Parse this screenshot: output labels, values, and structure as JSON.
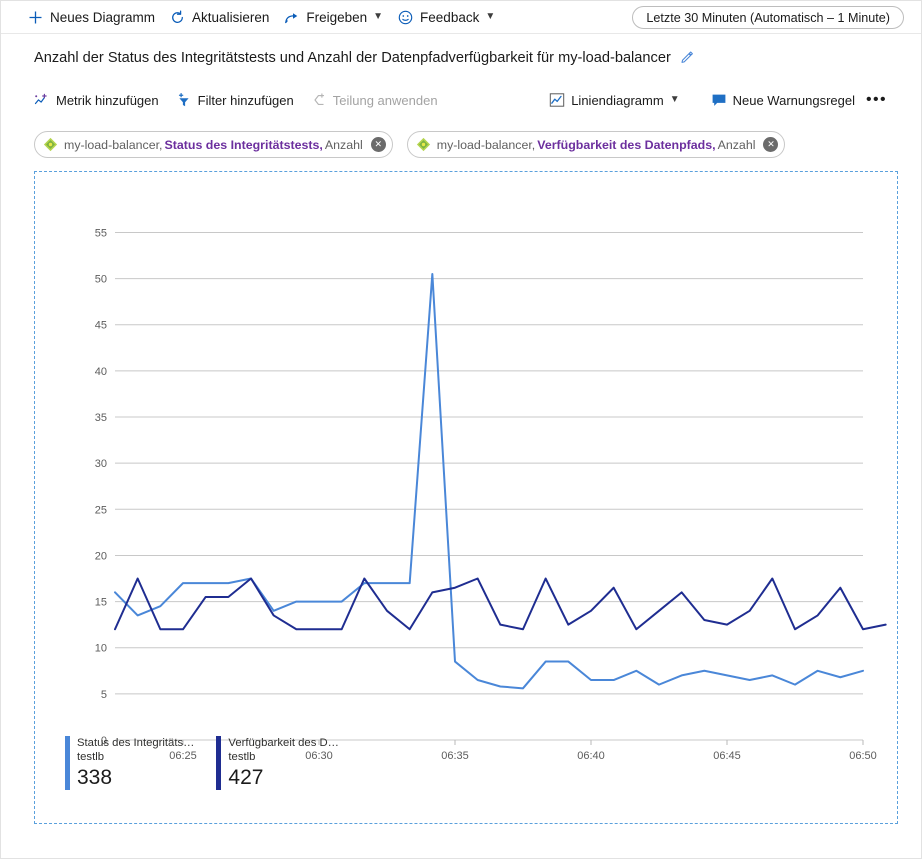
{
  "topbar": {
    "items": [
      {
        "label": "Neues Diagramm",
        "icon": "plus-icon",
        "chevron": false
      },
      {
        "label": "Aktualisieren",
        "icon": "refresh-icon",
        "chevron": false
      },
      {
        "label": "Freigeben",
        "icon": "share-icon",
        "chevron": true
      },
      {
        "label": "Feedback",
        "icon": "smiley-icon",
        "chevron": true
      }
    ],
    "time_range": "Letzte 30 Minuten (Automatisch – 1 Minute)"
  },
  "chart_header": {
    "title": "Anzahl der Status des Integritätstests und Anzahl der Datenpfadverfügbarkeit für my-load-balancer",
    "edit_icon": "pencil-icon"
  },
  "metric_toolbar": {
    "add_metric": "Metrik hinzufügen",
    "add_filter": "Filter hinzufügen",
    "apply_splitting": "Teilung anwenden",
    "chart_type": "Liniendiagramm",
    "new_alert_rule": "Neue Warnungsregel",
    "more_label": "•••"
  },
  "chips": [
    {
      "resource": "my-load-balancer,",
      "metric": "Status des Integritätstests,",
      "aggregation": "Anzahl",
      "icon": "load-balancer-icon",
      "close_icon": "close-icon"
    },
    {
      "resource": "my-load-balancer,",
      "metric": "Verfügbarkeit des Datenpfads,",
      "aggregation": "Anzahl",
      "icon": "load-balancer-icon",
      "close_icon": "close-icon"
    }
  ],
  "legend": [
    {
      "name": "Status des Integritäts…",
      "resource": "testlb",
      "value": "338",
      "color": "#4a87d8"
    },
    {
      "name": "Verfügbarkeit des D…",
      "resource": "testlb",
      "value": "427",
      "color": "#1f2d91"
    }
  ],
  "colors": {
    "accent": "#0078d4",
    "series_health_probe": "#4a87d8",
    "series_datapath": "#1f2d91",
    "metric_name": "#6c2f9e",
    "selection_border": "#5aa0dc",
    "gridline": "#c8c8c8"
  },
  "chart_data": {
    "type": "line",
    "title": "Anzahl der Status des Integritätstests und Anzahl der Datenpfadverfügbarkeit für my-load-balancer",
    "xlabel": "",
    "ylabel": "",
    "ylim": [
      0,
      57
    ],
    "yticks": [
      0,
      5,
      10,
      15,
      20,
      25,
      30,
      35,
      40,
      45,
      50,
      55
    ],
    "xticks": [
      "06:25",
      "06:30",
      "06:35",
      "06:40",
      "06:45",
      "06:50"
    ],
    "xtick_positions": [
      0.1,
      0.28,
      0.46,
      0.64,
      0.82,
      1.0
    ],
    "grid": true,
    "legend_position": "bottom-left",
    "x_count": 34,
    "series": [
      {
        "name": "Status des Integritätstests",
        "resource": "testlb",
        "color": "#4a87d8",
        "total": 338,
        "values": [
          16,
          13.5,
          14.5,
          17,
          17,
          17,
          17.5,
          14,
          15,
          15,
          15,
          17,
          17,
          17,
          50.5,
          8.5,
          6.5,
          5.8,
          5.6,
          8.5,
          8.5,
          6.5,
          6.5,
          7.5,
          6,
          7,
          7.5,
          7,
          6.5,
          7,
          6,
          7.5,
          6.8,
          7.5
        ]
      },
      {
        "name": "Verfügbarkeit des Datenpfads",
        "resource": "testlb",
        "color": "#1f2d91",
        "total": 427,
        "values": [
          12,
          17.5,
          12,
          12,
          15.5,
          15.5,
          17.5,
          13.5,
          12,
          12,
          12,
          17.5,
          14,
          12,
          16,
          16.5,
          17.5,
          12.5,
          12,
          17.5,
          12.5,
          14,
          16.5,
          12,
          14,
          16,
          13,
          12.5,
          14,
          17.5,
          12,
          13.5,
          16.5,
          12,
          12.5
        ]
      }
    ]
  }
}
